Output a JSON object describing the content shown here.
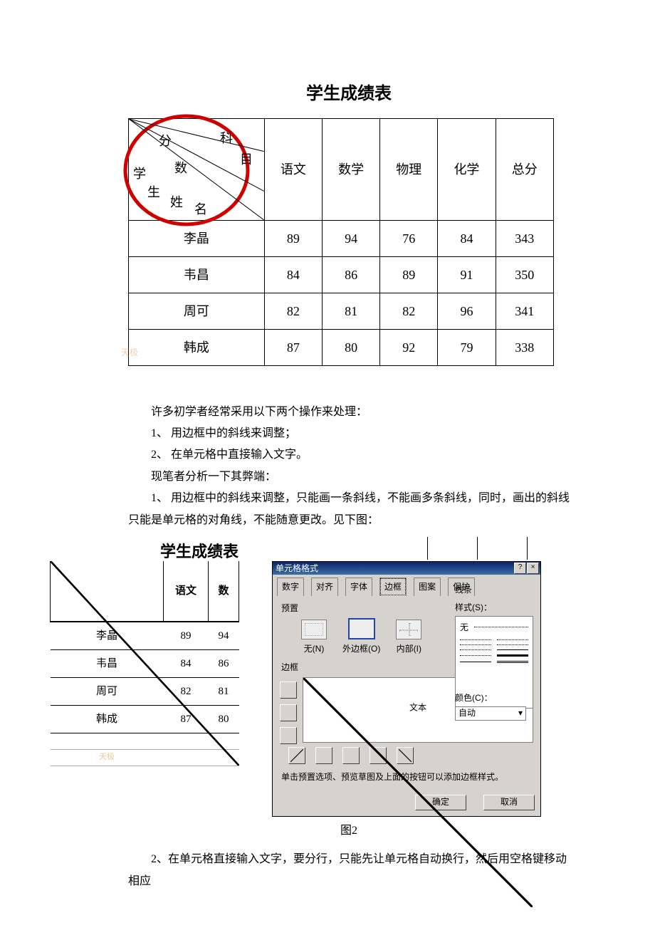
{
  "title1": "学生成绩表",
  "table1": {
    "header_corner": {
      "fen": "分",
      "shu": "数",
      "ke": "科",
      "mu": "目",
      "xue": "学",
      "sheng": "生",
      "xing": "姓",
      "ming": "名"
    },
    "columns": [
      "语文",
      "数学",
      "物理",
      "化学",
      "总分"
    ],
    "rows": [
      {
        "name": "李晶",
        "scores": [
          89,
          94,
          76,
          84,
          343
        ]
      },
      {
        "name": "韦昌",
        "scores": [
          84,
          86,
          89,
          91,
          350
        ]
      },
      {
        "name": "周可",
        "scores": [
          82,
          81,
          82,
          96,
          341
        ]
      },
      {
        "name": "韩成",
        "scores": [
          87,
          80,
          92,
          79,
          338
        ]
      }
    ]
  },
  "watermark": "天极",
  "para_intro": "许多初学者经常采用以下两个操作来处理：",
  "li1": "1、 用边框中的斜线来调整；",
  "li2": "2、 在单元格中直接输入文字。",
  "para_analyze": "现笔者分析一下其弊端：",
  "para_draw": "1、 用边框中的斜线来调整，只能画一条斜线，不能画多条斜线，同时，画出的斜线只能是单元格的对角线，不能随意更改。见下图：",
  "title2": "学生成绩表",
  "table2": {
    "columns": [
      "语文",
      "数学"
    ],
    "col2_display": "数",
    "rows": [
      {
        "name": "李晶",
        "scores": [
          89,
          94
        ]
      },
      {
        "name": "韦昌",
        "scores": [
          84,
          86
        ]
      },
      {
        "name": "周可",
        "scores": [
          82,
          81
        ]
      },
      {
        "name": "韩成",
        "scores": [
          87,
          80
        ]
      }
    ]
  },
  "dialog": {
    "title": "单元格格式",
    "help_btn": "?",
    "close_btn": "×",
    "tabs": [
      "数字",
      "对齐",
      "字体",
      "边框",
      "图案",
      "保护"
    ],
    "active_tab": "边框",
    "preset_label": "预置",
    "presets": [
      {
        "key": "none",
        "label": "无(N)"
      },
      {
        "key": "outer",
        "label": "外边框(O)"
      },
      {
        "key": "inner",
        "label": "内部(I)"
      }
    ],
    "border_label": "边框",
    "preview_text": "文本",
    "lines": {
      "group_label": "线条",
      "style_label": "样式(S)：",
      "none_label": "无"
    },
    "color": {
      "label": "颜色(C)：",
      "value": "自动"
    },
    "hint": "单击预置选项、预览草图及上面的按钮可以添加边框样式。",
    "ok": "确定",
    "cancel": "取消"
  },
  "fig2_caption": "图2",
  "para_last": "2、在单元格直接输入文字，要分行，只能先让单元格自动换行，然后用空格键移动相应"
}
